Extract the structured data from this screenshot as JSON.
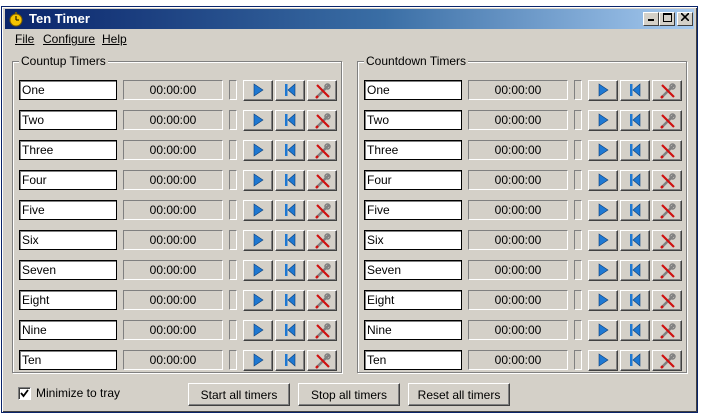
{
  "window": {
    "title": "Ten Timer"
  },
  "menu": [
    "File",
    "Configure",
    "Help"
  ],
  "countup": {
    "caption": "Countup Timers",
    "timers": [
      {
        "name": "One",
        "time": "00:00:00"
      },
      {
        "name": "Two",
        "time": "00:00:00"
      },
      {
        "name": "Three",
        "time": "00:00:00"
      },
      {
        "name": "Four",
        "time": "00:00:00"
      },
      {
        "name": "Five",
        "time": "00:00:00"
      },
      {
        "name": "Six",
        "time": "00:00:00"
      },
      {
        "name": "Seven",
        "time": "00:00:00"
      },
      {
        "name": "Eight",
        "time": "00:00:00"
      },
      {
        "name": "Nine",
        "time": "00:00:00"
      },
      {
        "name": "Ten",
        "time": "00:00:00"
      }
    ]
  },
  "countdown": {
    "caption": "Countdown Timers",
    "timers": [
      {
        "name": "One",
        "time": "00:00:00"
      },
      {
        "name": "Two",
        "time": "00:00:00"
      },
      {
        "name": "Three",
        "time": "00:00:00"
      },
      {
        "name": "Four",
        "time": "00:00:00"
      },
      {
        "name": "Five",
        "time": "00:00:00"
      },
      {
        "name": "Six",
        "time": "00:00:00"
      },
      {
        "name": "Seven",
        "time": "00:00:00"
      },
      {
        "name": "Eight",
        "time": "00:00:00"
      },
      {
        "name": "Nine",
        "time": "00:00:00"
      },
      {
        "name": "Ten",
        "time": "00:00:00"
      }
    ]
  },
  "footer": {
    "minimize_label": "Minimize to tray",
    "minimize_checked": true,
    "start_all": "Start all timers",
    "stop_all": "Stop all timers",
    "reset_all": "Reset all timers"
  },
  "colors": {
    "titlebar_start": "#0a246a",
    "titlebar_end": "#a6caf0",
    "face": "#d4d0c8",
    "play_icon": "#1e78d2",
    "reset_icon": "#1e78d2",
    "config_icon_red": "#d01010"
  },
  "icons": {
    "app": "stopwatch-icon",
    "start": "play-icon",
    "reset": "skip-back-icon",
    "configure": "wrench-cross-icon"
  }
}
